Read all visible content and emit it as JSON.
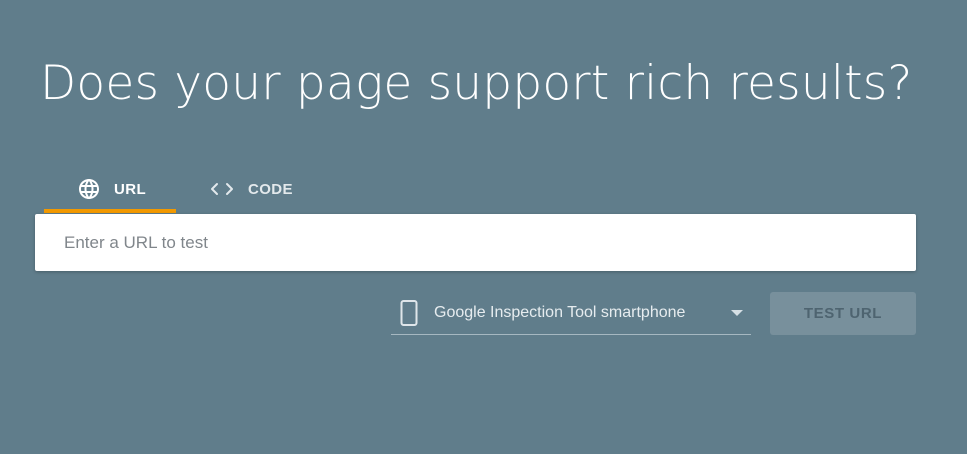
{
  "headline": "Does your page support rich results?",
  "tabs": [
    {
      "label": "URL",
      "icon": "globe-icon",
      "active": true
    },
    {
      "label": "CODE",
      "icon": "code-brackets-icon",
      "active": false
    }
  ],
  "url_input": {
    "placeholder": "Enter a URL to test",
    "value": ""
  },
  "device_select": {
    "icon": "smartphone-icon",
    "selected": "Google Inspection Tool smartphone"
  },
  "test_button": {
    "label": "TEST URL",
    "enabled": false
  },
  "colors": {
    "background": "#607d8b",
    "active_tab_indicator": "#f29900",
    "button_bg": "#78909c",
    "button_text": "#4e6470"
  }
}
